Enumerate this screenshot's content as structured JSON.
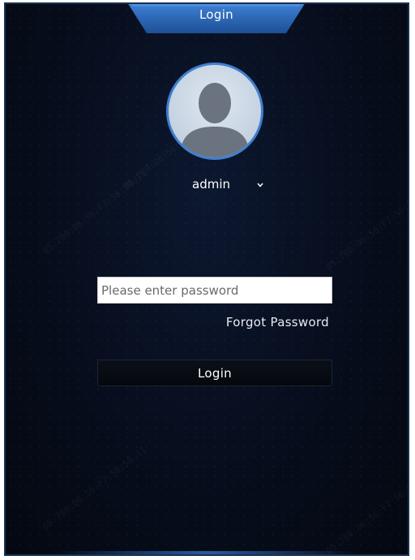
{
  "header": {
    "title": "Login"
  },
  "user": {
    "avatar_icon": "user-silhouette-icon",
    "selected": "admin",
    "dropdown_icon": "chevron-down-icon"
  },
  "password": {
    "placeholder": "Please enter password",
    "value": ""
  },
  "links": {
    "forgot": "Forgot Password"
  },
  "actions": {
    "login_label": "Login"
  },
  "watermark": {
    "text": "05:780:06:56:F7:56:58:11"
  },
  "colors": {
    "background": "#060b18",
    "accent": "#2f6fc4",
    "avatar_ring": "#3e7fd1",
    "input_bg": "#ffffff",
    "text": "#ffffff"
  }
}
